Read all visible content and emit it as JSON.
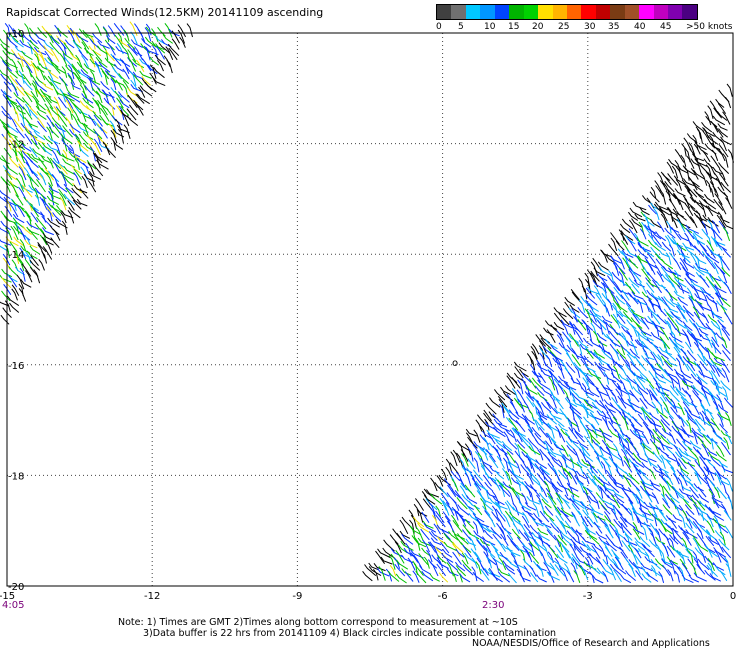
{
  "title": "Rapidscat Corrected Winds(12.5KM) 20141109 ascending",
  "legend": {
    "labels": [
      "0",
      "5",
      "10",
      "15",
      "20",
      "25",
      "30",
      "35",
      "40",
      "45",
      ">50 knots"
    ],
    "colors": [
      "#404040",
      "#707070",
      "#00c8ff",
      "#0096ff",
      "#0044ff",
      "#00b400",
      "#00d200",
      "#ffe000",
      "#ffb400",
      "#ff6400",
      "#ff0000",
      "#c00000",
      "#7a3c14",
      "#a05028",
      "#ff00ff",
      "#c000c0",
      "#8000b0",
      "#4b0082"
    ]
  },
  "axes": {
    "x_ticks": [
      "-15",
      "-12",
      "-9",
      "-6",
      "-3",
      "0"
    ],
    "y_ticks": [
      "-10",
      "-12",
      "-14",
      "-16",
      "-18",
      "-20"
    ],
    "x_range": [
      -15,
      0
    ],
    "y_range": [
      -20,
      -10
    ],
    "grid": true
  },
  "times": {
    "left": "4:05",
    "middle": "2:30"
  },
  "contamination_marker": "o",
  "wind_colors": {
    "light_blue": "#00aaff",
    "blue": "#0030ff",
    "green": "#00c000",
    "yellow": "#f0e000",
    "black": "#000000"
  },
  "note": {
    "line1": "Note: 1) Times are GMT 2)Times along bottom correspond to measurement at ~10S",
    "line2": "3)Data buffer is 22 hrs from 20141109 4) Black circles indicate possible contamination"
  },
  "credit": "NOAA/NESDIS/Office of Research and Applications"
}
